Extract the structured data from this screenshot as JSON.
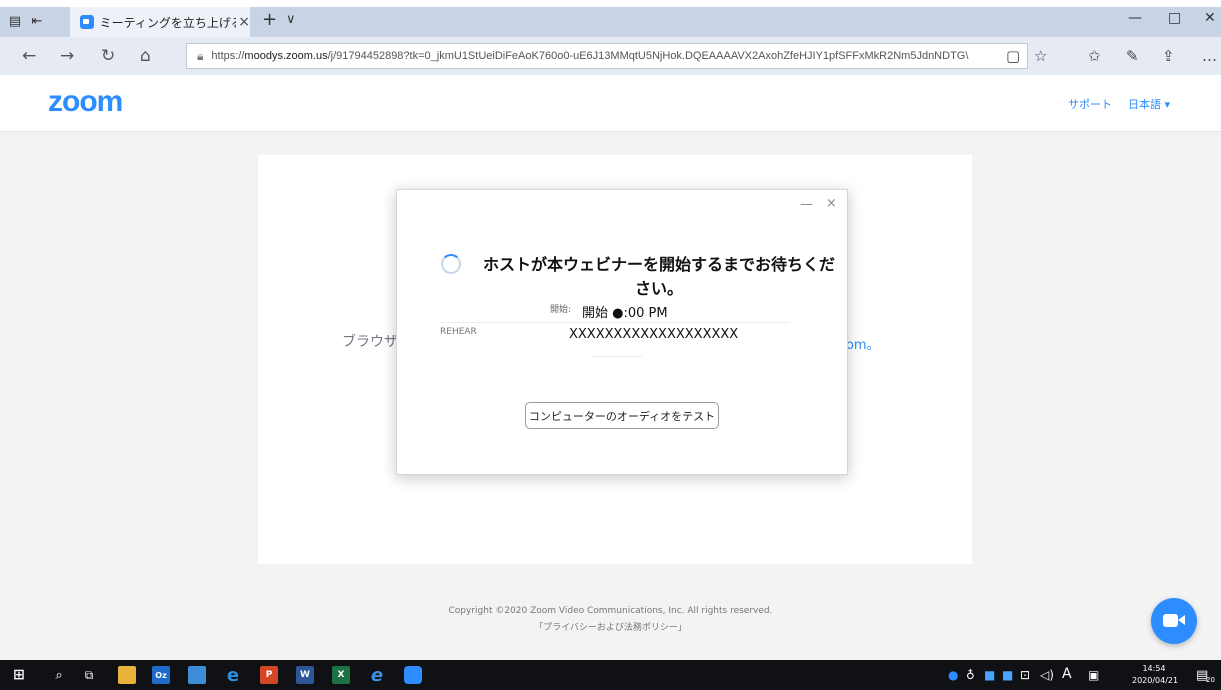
{
  "browser": {
    "tab_title": "ミーティングを立ち上げる - Z",
    "tab_close": "×",
    "new_tab": "+",
    "tab_menu": "∨",
    "url_prefix": "https://",
    "url_host": "moodys.zoom.us",
    "url_path": "/j/91794452898?tk=0_jkmU1StUeiDiFeAoK760o0-uE6J13MMqtU5NjHok.DQEAAAAVX2AxohZfeHJIY1pfSFFxMkR2Nm5JdnNDTG\\",
    "window_controls": [
      "—",
      "□",
      "✕"
    ]
  },
  "zoom_page": {
    "logo": "zoom",
    "support_link": "サポート",
    "language": "日本語 ▾",
    "background_text": "ブラウザ",
    "background_link": "oom。",
    "copyright": "Copyright ©2020 Zoom Video Communications, Inc. All rights reserved.",
    "privacy_link": "「プライバシーおよび法務ポリシー」"
  },
  "dialog": {
    "minimize": "—",
    "close": "×",
    "waiting_message": "ホストが本ウェビナーを開始するまでお待ちください。",
    "start_label_small": "開始:",
    "start_time": "開始 ●:00 PM",
    "rehearsal_label": "REHEAR",
    "webinar_name": "XXXXXXXXXXXXXXXXXXX",
    "test_audio_button": "コンピューターのオーディオをテスト"
  },
  "taskbar": {
    "time": "14:54",
    "date": "2020/04/21",
    "ime": "A",
    "notification_count": "20"
  }
}
